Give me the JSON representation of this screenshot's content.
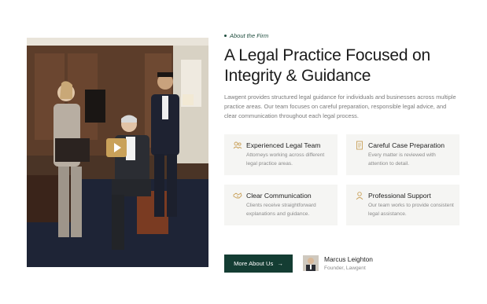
{
  "eyebrow": "About the Firm",
  "title": "A Legal Practice Focused on Integrity & Guidance",
  "description": "Lawgent provides structured legal guidance for individuals and businesses across multiple practice areas. Our team focuses on careful preparation, responsible legal advice, and clear communication throughout each legal process.",
  "features": [
    {
      "icon": "team-icon",
      "title": "Experienced Legal Team",
      "desc": "Attorneys working across different legal practice areas."
    },
    {
      "icon": "document-icon",
      "title": "Careful Case Preparation",
      "desc": "Every matter is reviewed with attention to detail."
    },
    {
      "icon": "handshake-icon",
      "title": "Clear Communication",
      "desc": "Clients receive straightforward explanations and guidance."
    },
    {
      "icon": "support-person-icon",
      "title": "Professional Support",
      "desc": "Our team works to provide consistent legal assistance."
    }
  ],
  "cta": {
    "label": "More About Us",
    "arrow": "→"
  },
  "person": {
    "name": "Marcus Leighton",
    "role": "Founder, Lawgent"
  },
  "colors": {
    "accent": "#143d33",
    "gold": "#c9a15a",
    "card_bg": "#f5f5f3"
  }
}
